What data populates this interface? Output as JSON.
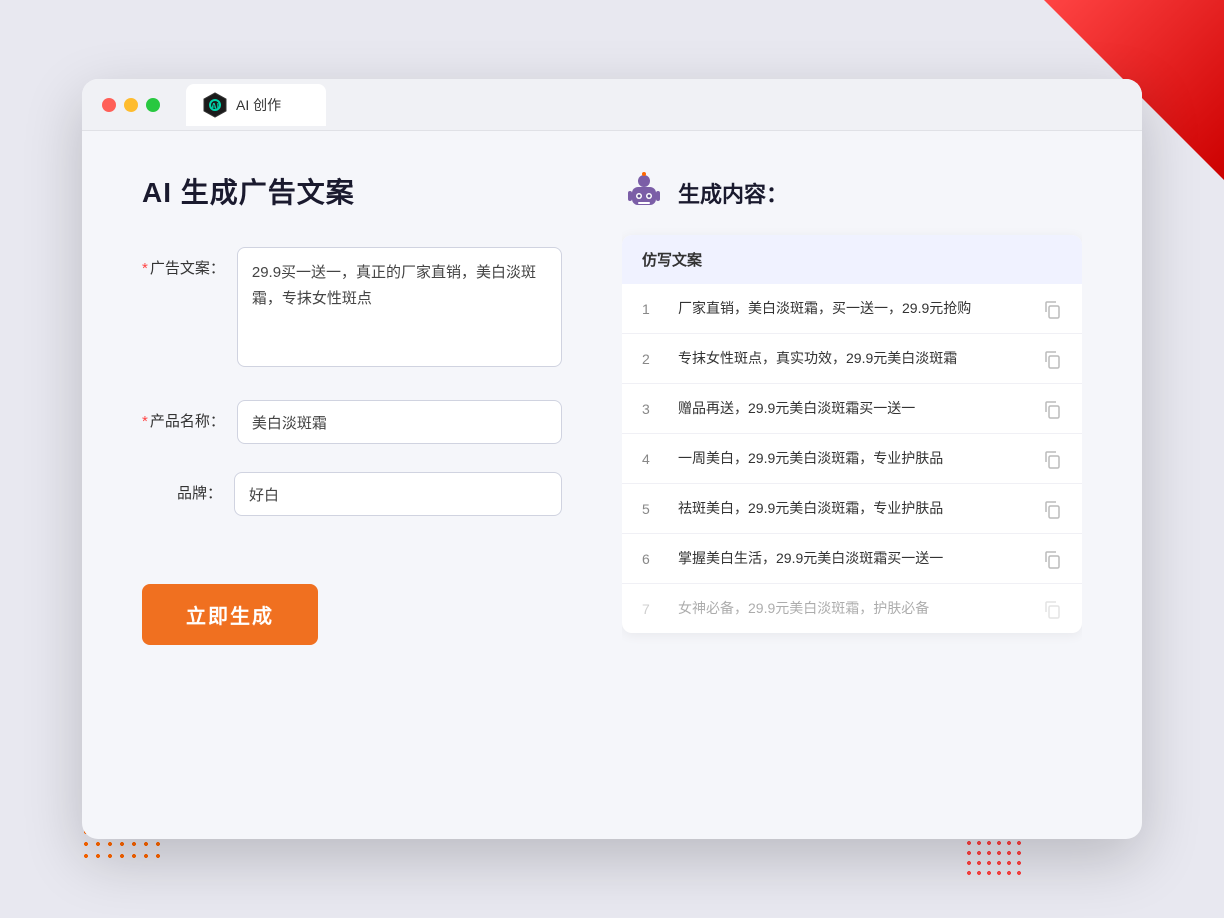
{
  "window": {
    "title": "AI 创作",
    "tab_label": "AI 创作"
  },
  "page": {
    "title": "AI 生成广告文案",
    "result_title": "生成内容："
  },
  "form": {
    "ad_copy_label": "广告文案：",
    "ad_copy_required": true,
    "ad_copy_value": "29.9买一送一，真正的厂家直销，美白淡斑霜，专抹女性斑点",
    "product_name_label": "产品名称：",
    "product_name_required": true,
    "product_name_value": "美白淡斑霜",
    "brand_label": "品牌：",
    "brand_required": false,
    "brand_value": "好白",
    "generate_button": "立即生成"
  },
  "results": {
    "header": "仿写文案",
    "items": [
      {
        "num": "1",
        "text": "厂家直销，美白淡斑霜，买一送一，29.9元抢购",
        "faded": false
      },
      {
        "num": "2",
        "text": "专抹女性斑点，真实功效，29.9元美白淡斑霜",
        "faded": false
      },
      {
        "num": "3",
        "text": "赠品再送，29.9元美白淡斑霜买一送一",
        "faded": false
      },
      {
        "num": "4",
        "text": "一周美白，29.9元美白淡斑霜，专业护肤品",
        "faded": false
      },
      {
        "num": "5",
        "text": "祛斑美白，29.9元美白淡斑霜，专业护肤品",
        "faded": false
      },
      {
        "num": "6",
        "text": "掌握美白生活，29.9元美白淡斑霜买一送一",
        "faded": false
      },
      {
        "num": "7",
        "text": "女神必备，29.9元美白淡斑霜，护肤必备",
        "faded": true
      }
    ]
  }
}
